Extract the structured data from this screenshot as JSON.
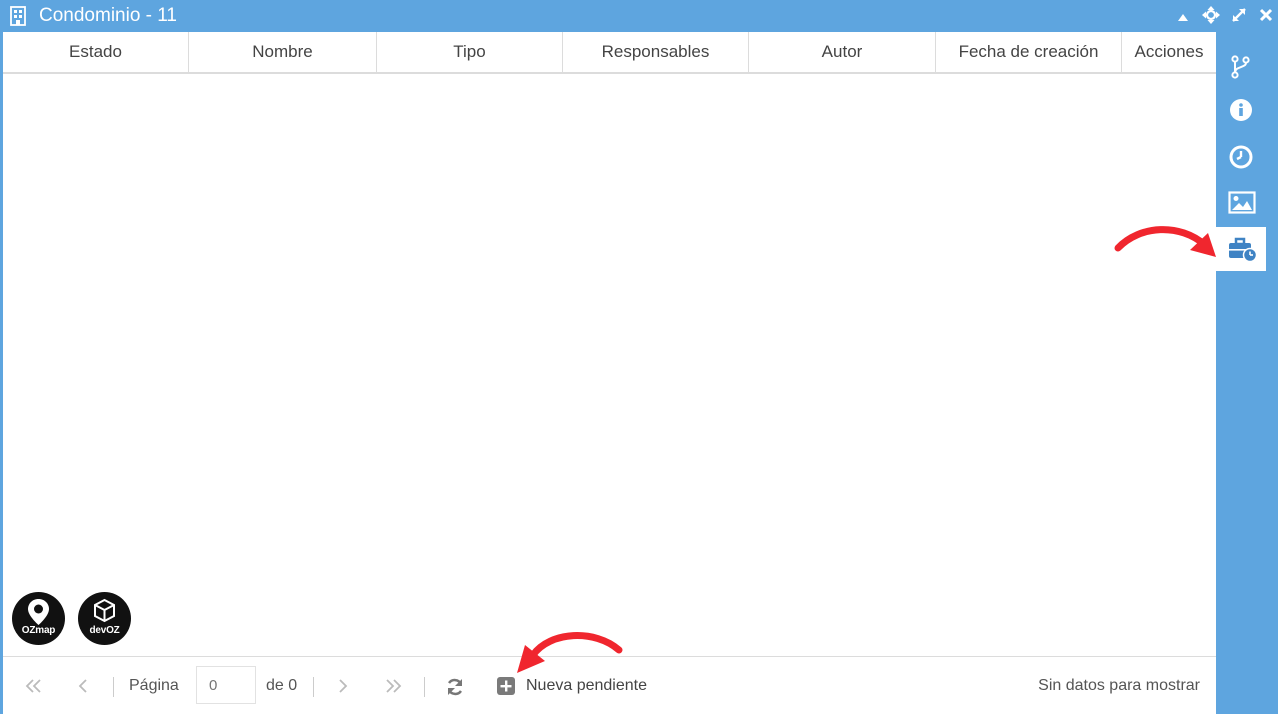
{
  "window": {
    "title": "Condominio - 11",
    "controls": [
      "collapse-icon",
      "move-icon",
      "maximize-icon",
      "close-icon"
    ]
  },
  "table": {
    "columns": [
      "Estado",
      "Nombre",
      "Tipo",
      "Responsables",
      "Autor",
      "Fecha de creación",
      "Acciones"
    ],
    "rows": []
  },
  "logos": {
    "ozmap": "OZmap",
    "devoz": "devOZ"
  },
  "pagination": {
    "page_label": "Página",
    "page_value": "",
    "page_placeholder": "0",
    "of_label": "de 0",
    "new_pending_label": "Nueva pendiente",
    "status": "Sin datos para mostrar"
  },
  "sidebar": {
    "items": [
      {
        "icon": "git-branch-icon"
      },
      {
        "icon": "info-icon"
      },
      {
        "icon": "clock-icon"
      },
      {
        "icon": "image-icon"
      },
      {
        "icon": "briefcase-clock-icon",
        "active": true
      }
    ]
  },
  "colors": {
    "primary": "#5ea5df",
    "active_icon": "#3f83c4",
    "annotation_arrow": "#f0262e"
  }
}
